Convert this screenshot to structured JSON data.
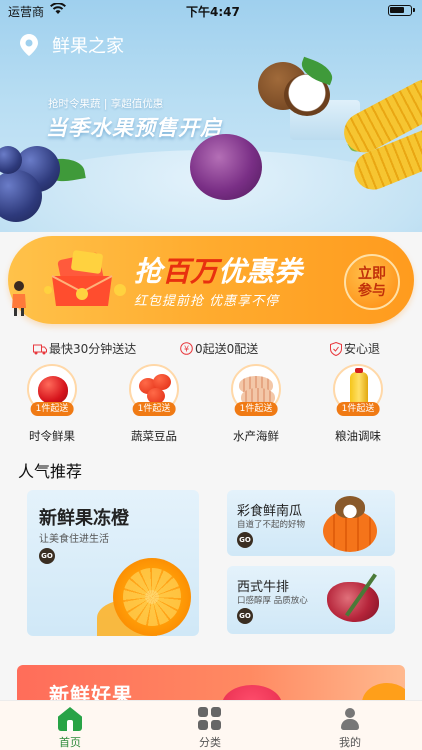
{
  "status_bar": {
    "carrier": "运营商",
    "time": "下午4:47"
  },
  "location": {
    "name": "鲜果之家"
  },
  "hero_banner": {
    "subtitle": "抢时令果蔬 | 享超值优惠",
    "title": "当季水果预售开启"
  },
  "coupon_banner": {
    "title_prefix": "抢",
    "title_highlight": "百万",
    "title_suffix": "优惠券",
    "subtitle": "红包提前抢 优惠享不停",
    "join_line1": "立即",
    "join_line2": "参与"
  },
  "features": [
    {
      "icon": "delivery-truck-icon",
      "text": "最快30分钟送达"
    },
    {
      "icon": "yuan-icon",
      "text": "0起送0配送"
    },
    {
      "icon": "shield-check-icon",
      "text": "安心退"
    }
  ],
  "categories": [
    {
      "label": "时令鲜果",
      "badge": "1件起送"
    },
    {
      "label": "蔬菜豆品",
      "badge": "1件起送"
    },
    {
      "label": "水产海鲜",
      "badge": "1件起送"
    },
    {
      "label": "粮油调味",
      "badge": "1件起送"
    }
  ],
  "popular": {
    "title": "人气推荐",
    "big_card": {
      "title": "新鲜果冻橙",
      "subtitle": "让美食住进生活",
      "go": "GO"
    },
    "small_cards": [
      {
        "title": "彩食鲜南瓜",
        "subtitle": "自道了不起的好物",
        "go": "GO"
      },
      {
        "title": "西式牛排",
        "subtitle": "口感醇厚 品质放心",
        "go": "GO"
      }
    ]
  },
  "bottom_banner": {
    "title": "新鲜好果"
  },
  "tab_bar": [
    {
      "label": "首页",
      "active": true
    },
    {
      "label": "分类",
      "active": false
    },
    {
      "label": "我的",
      "active": false
    }
  ],
  "colors": {
    "accent_green": "#28a347",
    "coupon_orange": "#ffab2e",
    "highlight_red": "#e8383d",
    "badge_orange": "#f07a14"
  }
}
